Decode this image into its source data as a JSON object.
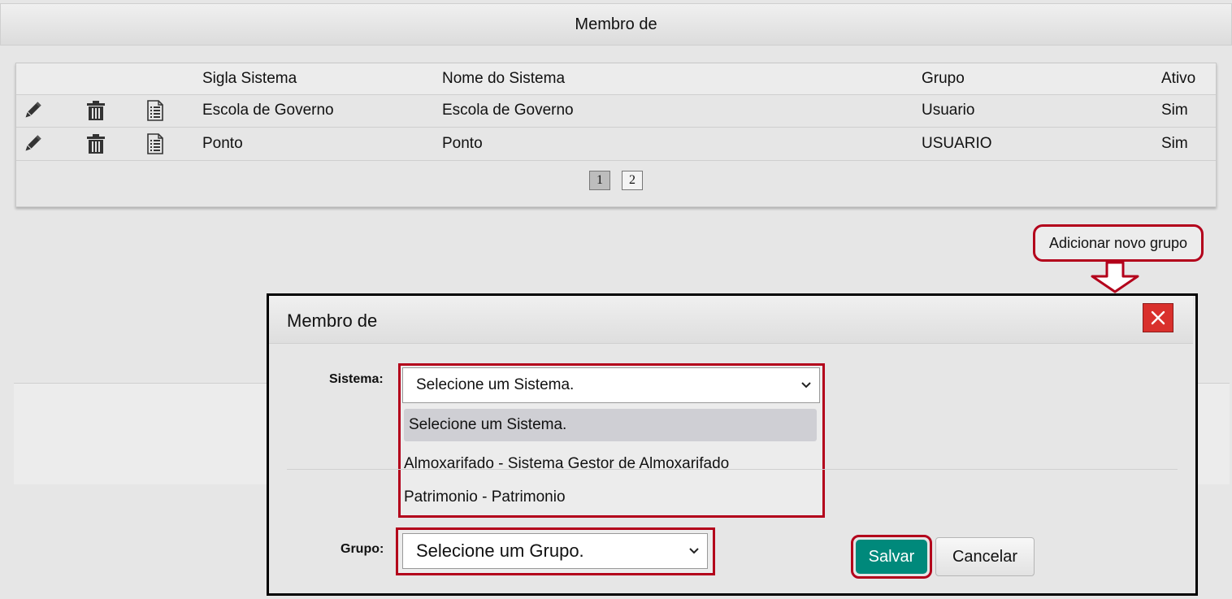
{
  "page": {
    "title": "Membro de"
  },
  "table": {
    "columns": [
      "Sigla Sistema",
      "Nome do Sistema",
      "Grupo",
      "Ativo"
    ],
    "rows": [
      {
        "sigla": "Escola de Governo",
        "nome": "Escola de Governo",
        "grupo": "Usuario",
        "ativo": "Sim"
      },
      {
        "sigla": "Ponto",
        "nome": "Ponto",
        "grupo": "USUARIO",
        "ativo": "Sim"
      }
    ],
    "icons": [
      "pencil-icon",
      "trash-icon",
      "document-list-icon"
    ]
  },
  "pagination": {
    "pages": [
      "1",
      "2"
    ],
    "current": "1"
  },
  "add_button": {
    "label": "Adicionar novo grupo"
  },
  "modal": {
    "title": "Membro de",
    "close_icon": "close-icon",
    "sistema": {
      "label": "Sistema:",
      "selected": "Selecione um Sistema.",
      "options": [
        "Selecione um Sistema.",
        "Almoxarifado - Sistema Gestor de Almoxarifado",
        "Patrimonio - Patrimonio"
      ]
    },
    "grupo": {
      "label": "Grupo:",
      "selected": "Selecione um Grupo."
    },
    "save_label": "Salvar",
    "cancel_label": "Cancelar"
  },
  "colors": {
    "highlight_border": "#b3001b",
    "save_button": "#00897b",
    "close_button": "#d9302c"
  }
}
